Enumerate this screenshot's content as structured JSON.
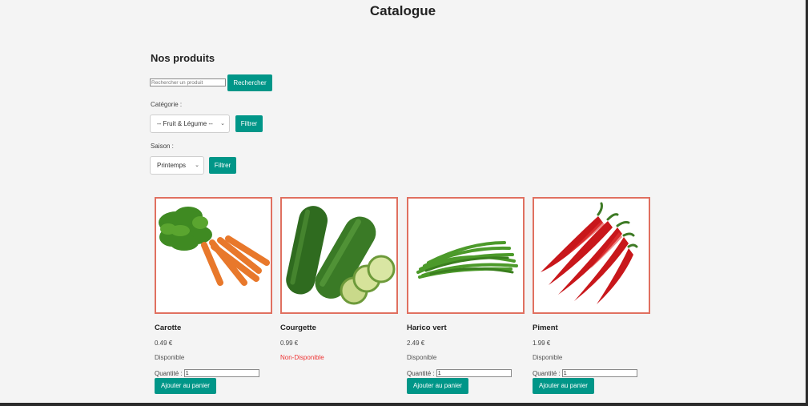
{
  "header": {
    "title": "Catalogue"
  },
  "products_section": {
    "title": "Nos produits",
    "search": {
      "placeholder": "Rechercher un produit",
      "button_label": "Rechercher"
    },
    "category_filter": {
      "label": "Catégorie :",
      "selected": "-- Fruit & Légume --",
      "button_label": "Filtrer"
    },
    "season_filter": {
      "label": "Saison :",
      "selected": "Printemps",
      "button_label": "Filtrer"
    }
  },
  "products": [
    {
      "name": "Carotte",
      "price": "0.49 €",
      "availability": "Disponible",
      "available": true,
      "quantity_label": "Quantité :",
      "quantity": "1",
      "cart_button": "Ajouter au panier",
      "image_icon": "carrot"
    },
    {
      "name": "Courgette",
      "price": "0.99 €",
      "availability": "Non-Disponible",
      "available": false,
      "quantity_label": "",
      "quantity": "",
      "cart_button": "",
      "image_icon": "zucchini"
    },
    {
      "name": "Harico vert",
      "price": "2.49 €",
      "availability": "Disponible",
      "available": true,
      "quantity_label": "Quantité :",
      "quantity": "1",
      "cart_button": "Ajouter au panier",
      "image_icon": "green-beans"
    },
    {
      "name": "Piment",
      "price": "1.99 €",
      "availability": "Disponible",
      "available": true,
      "quantity_label": "Quantité :",
      "quantity": "1",
      "cart_button": "Ajouter au panier",
      "image_icon": "chili-pepper"
    }
  ],
  "colors": {
    "accent": "#009688",
    "card_border": "#e07060",
    "unavailable": "#ee3333"
  }
}
